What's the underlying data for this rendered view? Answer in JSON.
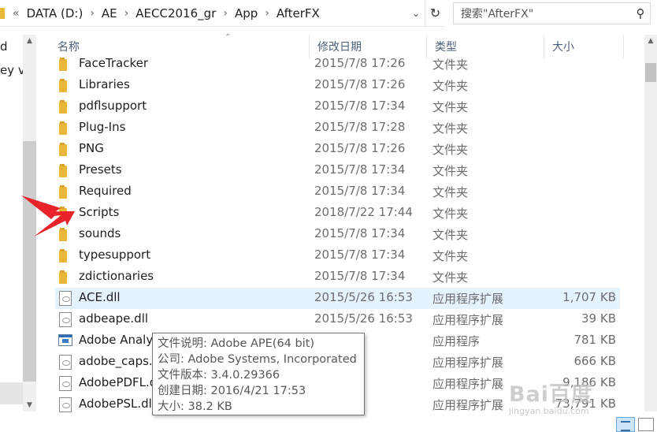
{
  "address": {
    "breadcrumbs": [
      "DATA (D:)",
      "AE",
      "AECC2016_gr",
      "App",
      "AfterFX"
    ],
    "overflow_chevron": "«",
    "separator": "›"
  },
  "search": {
    "placeholder": "搜索\"AfterFX\""
  },
  "nav_pane": {
    "items": [
      "d",
      "ey v'"
    ]
  },
  "columns": {
    "name": "名称",
    "date": "修改日期",
    "type": "类型",
    "size": "大小"
  },
  "files": [
    {
      "name": "FaceTracker",
      "date": "2015/7/8 17:26",
      "type": "文件夹",
      "size": "",
      "icon": "folder-icon"
    },
    {
      "name": "Libraries",
      "date": "2015/7/8 17:26",
      "type": "文件夹",
      "size": "",
      "icon": "folder-icon"
    },
    {
      "name": "pdflsupport",
      "date": "2015/7/8 17:34",
      "type": "文件夹",
      "size": "",
      "icon": "folder-icon"
    },
    {
      "name": "Plug-Ins",
      "date": "2015/7/8 17:28",
      "type": "文件夹",
      "size": "",
      "icon": "folder-icon"
    },
    {
      "name": "PNG",
      "date": "2015/7/8 17:26",
      "type": "文件夹",
      "size": "",
      "icon": "folder-icon"
    },
    {
      "name": "Presets",
      "date": "2015/7/8 17:34",
      "type": "文件夹",
      "size": "",
      "icon": "folder-icon"
    },
    {
      "name": "Required",
      "date": "2015/7/8 17:34",
      "type": "文件夹",
      "size": "",
      "icon": "folder-icon"
    },
    {
      "name": "Scripts",
      "date": "2018/7/22 17:44",
      "type": "文件夹",
      "size": "",
      "icon": "folder-icon"
    },
    {
      "name": "sounds",
      "date": "2015/7/8 17:34",
      "type": "文件夹",
      "size": "",
      "icon": "folder-icon"
    },
    {
      "name": "typesupport",
      "date": "2015/7/8 17:34",
      "type": "文件夹",
      "size": "",
      "icon": "folder-icon"
    },
    {
      "name": "zdictionaries",
      "date": "2015/7/8 17:34",
      "type": "文件夹",
      "size": "",
      "icon": "folder-icon"
    },
    {
      "name": "ACE.dll",
      "date": "2015/5/26 16:53",
      "type": "应用程序扩展",
      "size": "1,707 KB",
      "icon": "dll-file-icon",
      "selected": true
    },
    {
      "name": "adbeape.dll",
      "date": "2015/5/26 16:53",
      "type": "应用程序扩展",
      "size": "39 KB",
      "icon": "dll-file-icon"
    },
    {
      "name": "Adobe Analy",
      "date": "6 16:53",
      "type": "应用程序",
      "size": "781 KB",
      "icon": "exe-app-icon"
    },
    {
      "name": "adobe_caps.d",
      "date": "6 16:53",
      "type": "应用程序扩展",
      "size": "666 KB",
      "icon": "dll-file-icon"
    },
    {
      "name": "AdobePDFL.d",
      "date": "6 16:53",
      "type": "应用程序扩展",
      "size": "9,186 KB",
      "icon": "dll-file-icon"
    },
    {
      "name": "AdobePSL.dl",
      "date": "6 16:53",
      "type": "应用程序扩展",
      "size": "73,791 KB",
      "icon": "dll-file-icon"
    }
  ],
  "tooltip": {
    "lines": [
      "文件说明: Adobe APE(64 bit)",
      "公司: Adobe Systems, Incorporated",
      "文件版本: 3.4.0.29366",
      "创建日期: 2016/4/21 17:53",
      "大小: 38.2 KB"
    ]
  },
  "watermark": {
    "logo": "Bai百度",
    "sub": "jingyan.baidu.com"
  },
  "colors": {
    "header_text": "#4c607a",
    "selection": "#e5f3ff",
    "folder": "#e8b738",
    "arrow": "#e8232a",
    "secondary_text": "#6d6d6d"
  }
}
